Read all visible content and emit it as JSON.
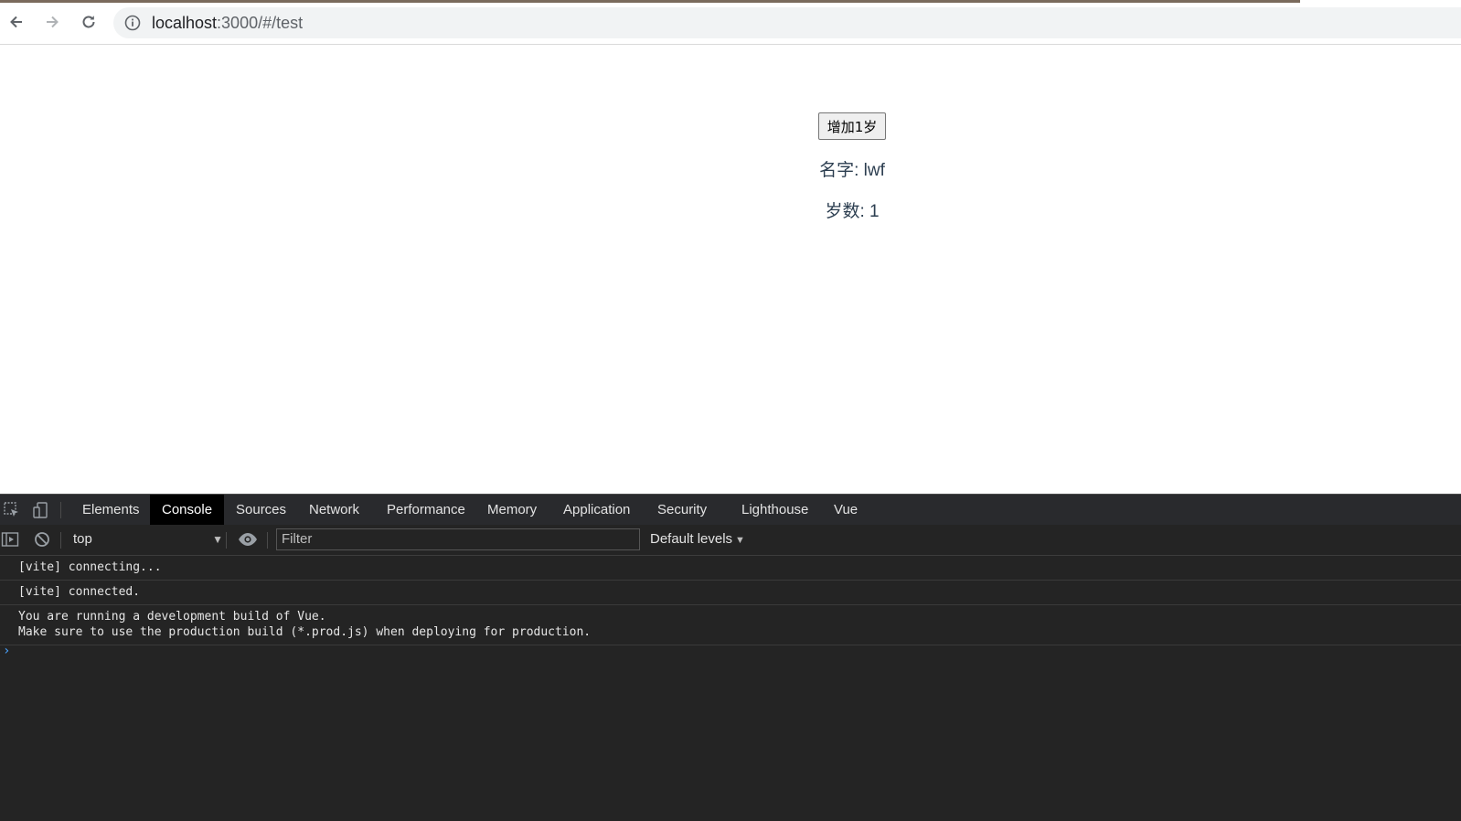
{
  "browser": {
    "url_host": "localhost",
    "url_rest": ":3000/#/test"
  },
  "app": {
    "button_label": "增加1岁",
    "name_line": "名字: lwf",
    "age_line": "岁数: 1"
  },
  "devtools": {
    "tabs": [
      "Elements",
      "Console",
      "Sources",
      "Network",
      "Performance",
      "Memory",
      "Application",
      "Security",
      "Lighthouse",
      "Vue"
    ],
    "active_tab": "Console",
    "context": "top",
    "filter_placeholder": "Filter",
    "levels": "Default levels",
    "messages": [
      "[vite] connecting...",
      "[vite] connected.",
      "You are running a development build of Vue.\nMake sure to use the production build (*.prod.js) when deploying for production."
    ]
  },
  "colors": {
    "app_text": "#2c3e50",
    "devtools_bg": "#242424",
    "active_tab_bg": "#000000",
    "prompt": "#4aa3ff"
  }
}
